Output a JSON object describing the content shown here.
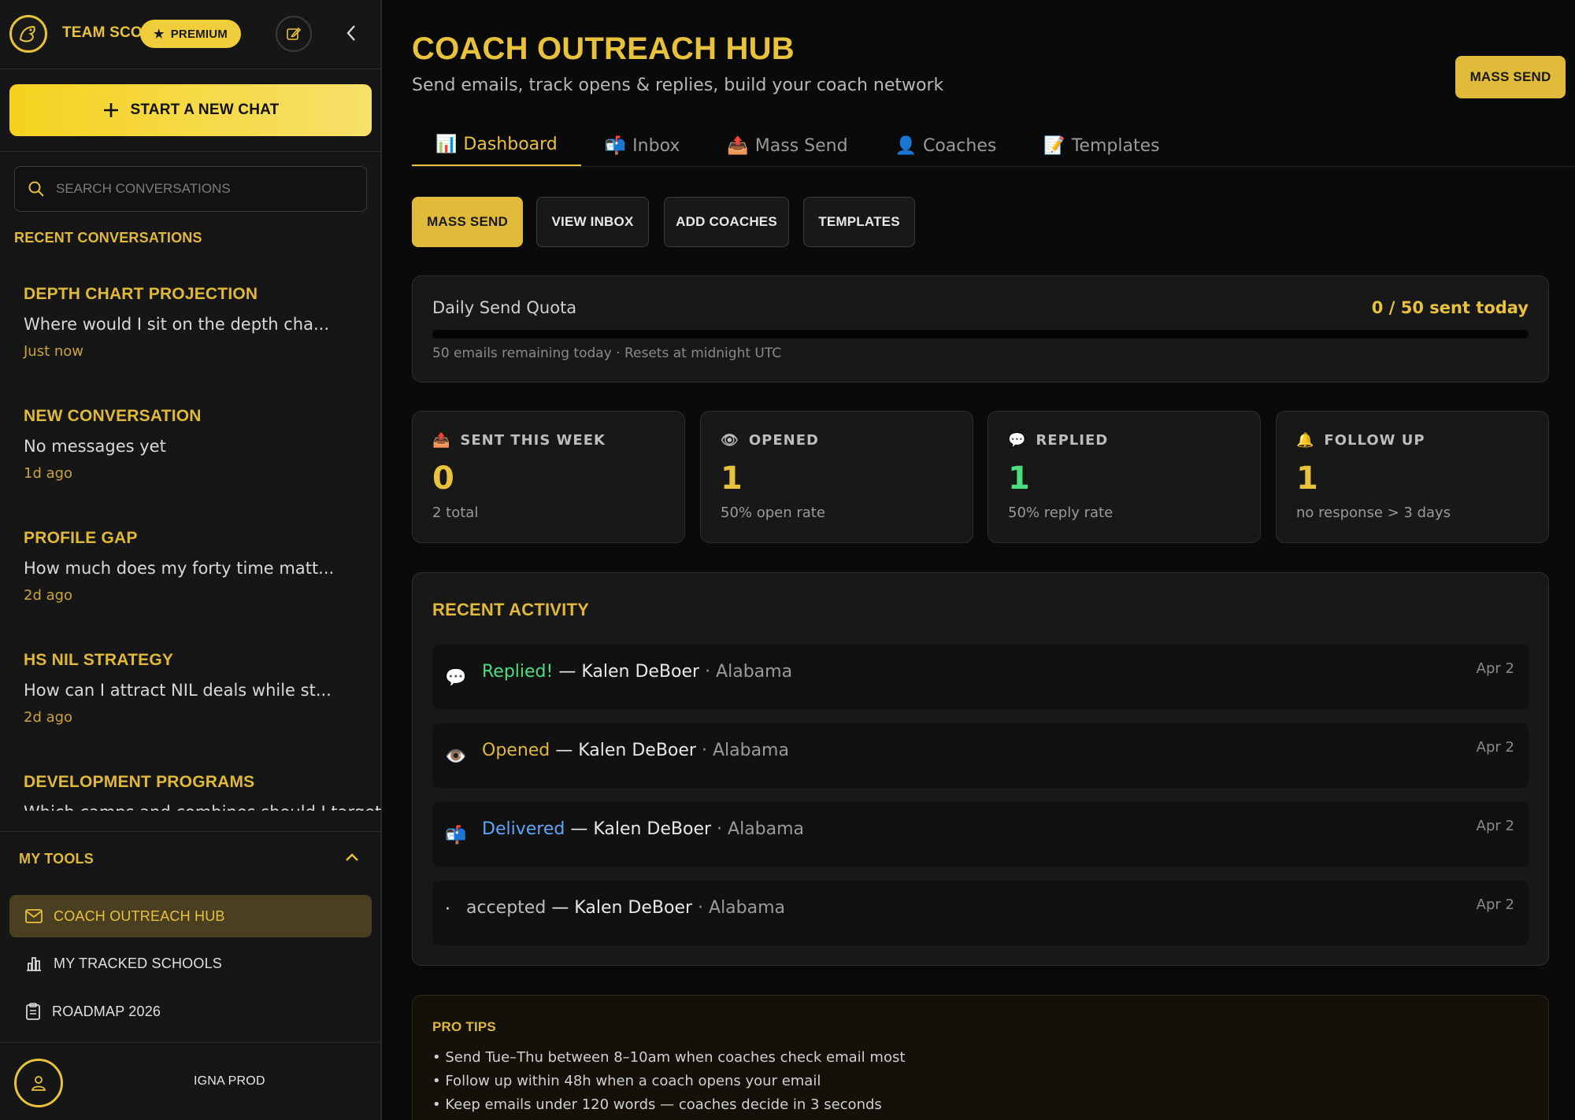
{
  "sidebar": {
    "brand": "TEAM SCOUT",
    "premium_label": "PREMIUM",
    "new_chat_label": "START A NEW CHAT",
    "search_placeholder": "SEARCH CONVERSATIONS",
    "recent_heading": "RECENT CONVERSATIONS",
    "conversations": [
      {
        "title": "DEPTH CHART PROJECTION",
        "preview": "Where would I sit on the depth cha...",
        "time": "Just now"
      },
      {
        "title": "NEW CONVERSATION",
        "preview": "No messages yet",
        "time": "1d ago"
      },
      {
        "title": "PROFILE GAP",
        "preview": "How much does my forty time matt...",
        "time": "2d ago"
      },
      {
        "title": "HS NIL STRATEGY",
        "preview": "How can I attract NIL deals while st...",
        "time": "2d ago"
      },
      {
        "title": "DEVELOPMENT PROGRAMS",
        "preview": "Which camps and combines should I target...",
        "time": ""
      }
    ],
    "tools_heading": "MY TOOLS",
    "tools": [
      {
        "label": "COACH OUTREACH HUB",
        "icon": "mail-icon"
      },
      {
        "label": "MY TRACKED SCHOOLS",
        "icon": "bar-chart-icon"
      },
      {
        "label": "ROADMAP 2026",
        "icon": "clipboard-icon"
      }
    ],
    "user_name": "IGNA PROD"
  },
  "header": {
    "title": "COACH OUTREACH HUB",
    "subtitle": "Send emails, track opens & replies, build your coach network",
    "mass_send_label": "MASS SEND"
  },
  "tabs": [
    {
      "icon": "📊",
      "label": "Dashboard"
    },
    {
      "icon": "📬",
      "label": "Inbox"
    },
    {
      "icon": "📤",
      "label": "Mass Send"
    },
    {
      "icon": "👤",
      "label": "Coaches"
    },
    {
      "icon": "📝",
      "label": "Templates"
    }
  ],
  "quick_actions": [
    "MASS SEND",
    "VIEW INBOX",
    "ADD COACHES",
    "TEMPLATES"
  ],
  "quota": {
    "label": "Daily Send Quota",
    "value_text": "0 / 50 sent today",
    "progress": 0,
    "note": "50 emails remaining today · Resets at midnight UTC"
  },
  "stats": [
    {
      "icon": "📤",
      "label": "SENT THIS WEEK",
      "value": "0",
      "sub": "2 total",
      "color": "#e8c23c"
    },
    {
      "icon": "👁",
      "label": "OPENED",
      "value": "1",
      "sub": "50% open rate",
      "color": "#e8c23c"
    },
    {
      "icon": "💬",
      "label": "REPLIED",
      "value": "1",
      "sub": "50% reply rate",
      "color": "#4ade80"
    },
    {
      "icon": "🔔",
      "label": "FOLLOW UP",
      "value": "1",
      "sub": "no response > 3 days",
      "color": "#e8c23c"
    }
  ],
  "activity": {
    "heading": "RECENT ACTIVITY",
    "items": [
      {
        "icon": "💬",
        "status": "Replied!",
        "status_color": "#4ade80",
        "coach": "— Kalen DeBoer",
        "school": "· Alabama",
        "date": "Apr 2"
      },
      {
        "icon": "👁️",
        "status": "Opened",
        "status_color": "#e0b93a",
        "coach": "— Kalen DeBoer",
        "school": "· Alabama",
        "date": "Apr 2"
      },
      {
        "icon": "📬",
        "status": "Delivered",
        "status_color": "#60a5fa",
        "coach": "— Kalen DeBoer",
        "school": "· Alabama",
        "date": "Apr 2"
      },
      {
        "icon": "·",
        "status": "accepted",
        "status_color": "#bdbdbd",
        "coach": "— Kalen DeBoer",
        "school": "· Alabama",
        "date": "Apr 2"
      }
    ]
  },
  "tips": {
    "heading": "PRO TIPS",
    "items": [
      "• Send Tue–Thu between 8–10am when coaches check email most",
      "• Follow up within 48h when a coach opens your email",
      "• Keep emails under 120 words — coaches decide in 3 seconds"
    ]
  },
  "colors": {
    "accent": "#e8c23c",
    "replied": "#4ade80",
    "delivered": "#60a5fa",
    "background": "#0a0a0a"
  }
}
